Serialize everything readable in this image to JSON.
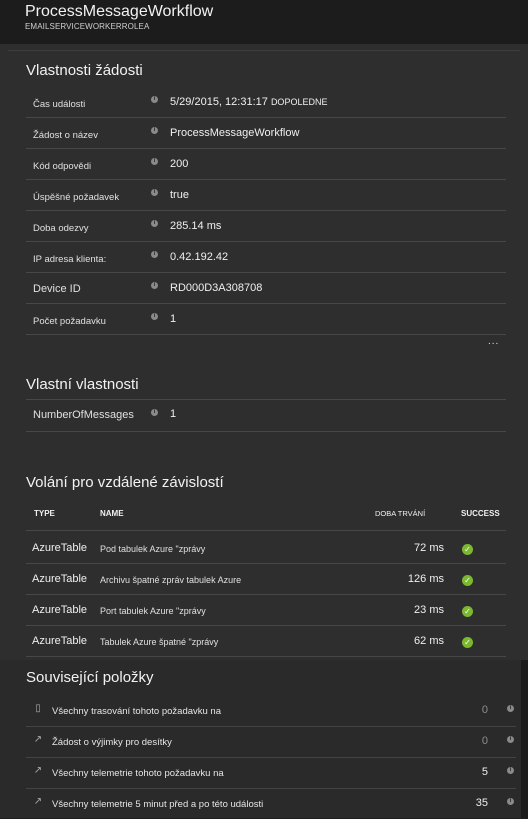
{
  "header": {
    "title": "ProcessMessageWorkflow",
    "subtitle": "EMAILSERVICEWORKERROLEA"
  },
  "request_properties": {
    "title": "Vlastnosti žádosti",
    "rows": [
      {
        "label": "Čas události",
        "value": "5/29/2015, 12:31:17",
        "suffix": "DOPOLEDNE"
      },
      {
        "label": "Žádost o název",
        "value": "ProcessMessageWorkflow"
      },
      {
        "label": "Kód odpovědi",
        "value": "200"
      },
      {
        "label": "Úspěšné požadavek",
        "value": "true"
      },
      {
        "label": "Doba odezvy",
        "value": "285.14 ms"
      },
      {
        "label": "IP adresa klienta:",
        "value": "0.42.192.42"
      },
      {
        "label": "Device ID",
        "value": "RD000D3A308708"
      },
      {
        "label": "Počet požadavku",
        "value": "1"
      }
    ],
    "more": "..."
  },
  "custom_properties": {
    "title": "Vlastní vlastnosti",
    "rows": [
      {
        "label": "NumberOfMessages",
        "value": "1"
      }
    ]
  },
  "dependencies": {
    "title": "Volání pro vzdálené závislostí",
    "columns": {
      "type": "TYPE",
      "name": "NAME",
      "duration": "DOBA TRVÁNÍ",
      "success": "SUCCESS"
    },
    "rows": [
      {
        "type": "AzureTable",
        "name": "Pod tabulek Azure \"zprávy",
        "duration": "72 ms"
      },
      {
        "type": "AzureTable",
        "name": "Archivu špatné zpráv tabulek Azure",
        "duration": "126 ms"
      },
      {
        "type": "AzureTable",
        "name": "Port tabulek Azure \"zprávy",
        "duration": "23 ms"
      },
      {
        "type": "AzureTable",
        "name": "Tabulek Azure špatné \"zprávy",
        "duration": "62 ms"
      }
    ],
    "success_color": "#7cb82f"
  },
  "related": {
    "title": "Související položky",
    "rows": [
      {
        "icon": "document-icon",
        "label": "Všechny trasování tohoto požadavku na",
        "count": "0"
      },
      {
        "icon": "arrow-icon",
        "label": "Žádost o výjimky pro desítky",
        "count": "0"
      },
      {
        "icon": "arrow-icon",
        "label": "Všechny telemetrie tohoto požadavku na",
        "count": "5"
      },
      {
        "icon": "arrow-icon",
        "label": "Všechny telemetrie 5 minut před a po této události",
        "count": "35"
      }
    ]
  }
}
